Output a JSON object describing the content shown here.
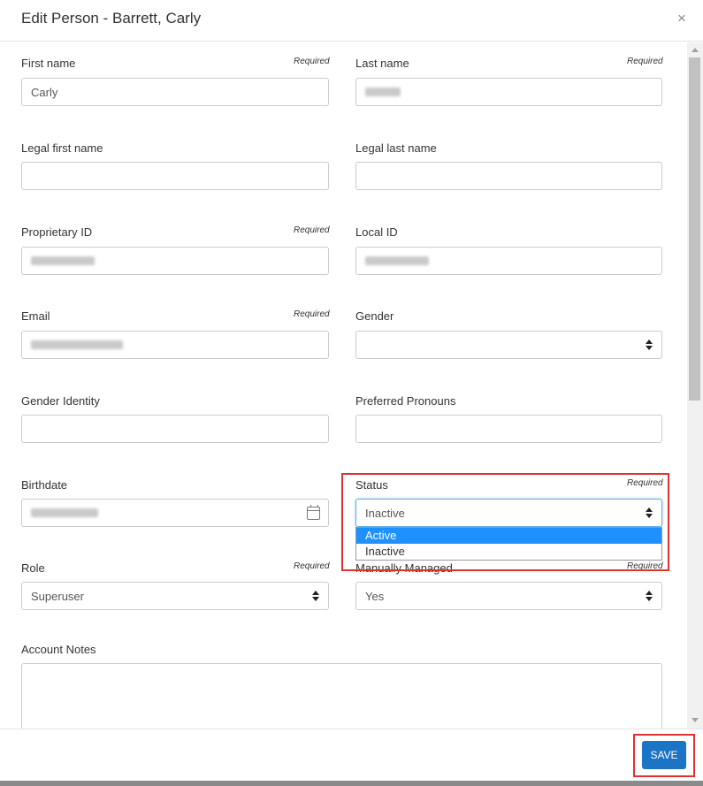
{
  "dialog": {
    "title": "Edit Person - Barrett, Carly",
    "close_icon": "×"
  },
  "form": {
    "required_text": "Required",
    "first_name": {
      "label": "First name",
      "value": "Carly"
    },
    "last_name": {
      "label": "Last name"
    },
    "legal_first_name": {
      "label": "Legal first name",
      "value": ""
    },
    "legal_last_name": {
      "label": "Legal last name",
      "value": ""
    },
    "proprietary_id": {
      "label": "Proprietary ID"
    },
    "local_id": {
      "label": "Local ID"
    },
    "email": {
      "label": "Email"
    },
    "gender": {
      "label": "Gender",
      "value": ""
    },
    "gender_identity": {
      "label": "Gender Identity",
      "value": ""
    },
    "preferred_pronouns": {
      "label": "Preferred Pronouns",
      "value": ""
    },
    "birthdate": {
      "label": "Birthdate"
    },
    "status": {
      "label": "Status",
      "value": "Inactive",
      "options": [
        "Active",
        "Inactive"
      ]
    },
    "role": {
      "label": "Role",
      "value": "Superuser"
    },
    "manually_managed": {
      "label": "Manually Managed",
      "value": "Yes"
    },
    "account_notes": {
      "label": "Account Notes",
      "value": ""
    }
  },
  "footer": {
    "save_label": "SAVE"
  },
  "colors": {
    "accent": "#1b74c4",
    "highlight": "#e03131",
    "selected_option": "#1e90ff"
  }
}
